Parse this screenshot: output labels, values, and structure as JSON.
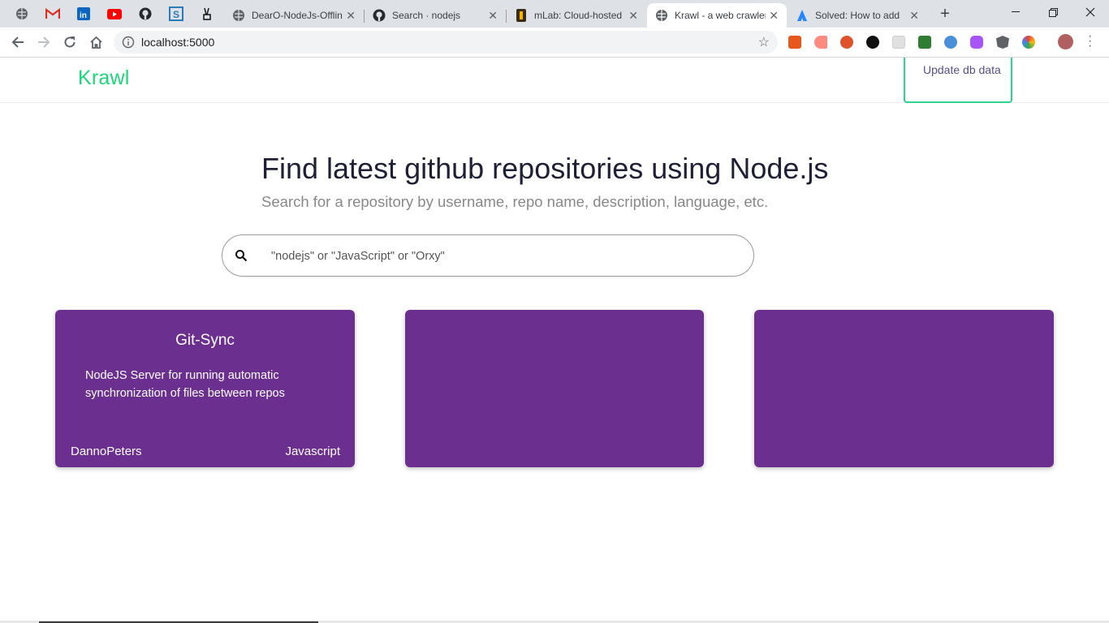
{
  "browser": {
    "pinned_tabs": [
      {
        "icon": "globe-icon"
      },
      {
        "icon": "gmail-icon",
        "color": "#d93025"
      },
      {
        "icon": "linkedin-icon",
        "color": "#0a66c2"
      },
      {
        "icon": "youtube-icon",
        "color": "#ff0000"
      },
      {
        "icon": "github-icon",
        "color": "#24292e"
      },
      {
        "icon": "s-app-icon",
        "color": "#2b7bb9"
      },
      {
        "icon": "angellist-icon",
        "color": "#000000"
      }
    ],
    "tabs": [
      {
        "title": "DearO-NodeJs-Offline",
        "icon": "globe-icon"
      },
      {
        "title": "Search · nodejs",
        "icon": "github-icon"
      },
      {
        "title": "mLab: Cloud-hosted",
        "icon": "mlab-icon"
      },
      {
        "title": "Krawl - a web crawler",
        "icon": "globe-icon",
        "active": true
      },
      {
        "title": "Solved: How to add",
        "icon": "atlassian-icon"
      }
    ],
    "url": "localhost:5000",
    "extension_colors": [
      "#e8581c",
      "#ff7070",
      "#e0522b",
      "#111111",
      "#d0d0d0",
      "#2e7d32",
      "#4a90d9",
      "#a855f7",
      "#5f6368",
      "#f4b400",
      "#b06060"
    ]
  },
  "app": {
    "brand": "Krawl",
    "brand_color": "#1ed67a",
    "update_button": "Update db data",
    "hero_title": "Find latest github repositories using Node.js",
    "hero_subtitle": "Search for a repository by username, repo name, description, language, etc.",
    "search_placeholder": "\"nodejs\" or \"JavaScript\" or \"Orxy\"",
    "card_color": "#6b308f",
    "cards": [
      {
        "name": "Git-Sync",
        "description": "NodeJS Server for running automatic synchronization of files between repos",
        "owner": "DannoPeters",
        "language": "Javascript"
      },
      {
        "name": "",
        "description": "",
        "owner": "",
        "language": ""
      },
      {
        "name": "",
        "description": "",
        "owner": "",
        "language": ""
      }
    ]
  }
}
